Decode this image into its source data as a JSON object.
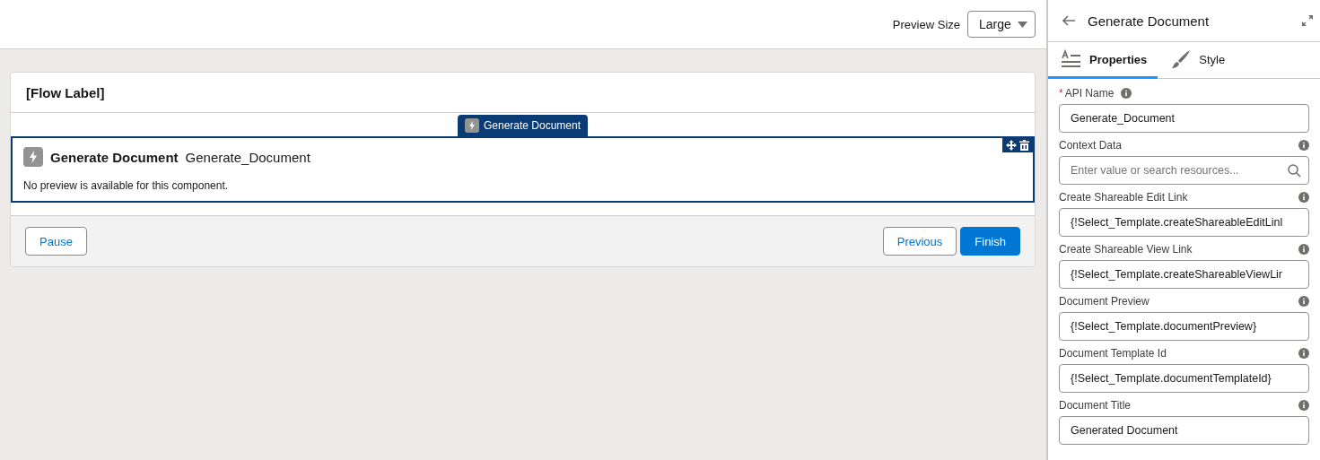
{
  "toolbar": {
    "preview_size_label": "Preview Size",
    "preview_size_value": "Large"
  },
  "screen": {
    "flow_label": "[Flow Label]",
    "component_tab": "Generate Document",
    "component": {
      "title": "Generate Document",
      "api_name": "Generate_Document",
      "message": "No preview is available for this component.",
      "selected": true
    },
    "footer": {
      "left_buttons": [
        {
          "label": "Pause",
          "kind": "neutral"
        }
      ],
      "right_buttons": [
        {
          "label": "Previous",
          "kind": "neutral"
        },
        {
          "label": "Finish",
          "kind": "brand"
        }
      ]
    }
  },
  "panel": {
    "title": "Generate Document",
    "tabs": [
      {
        "label": "Properties",
        "selected": true
      },
      {
        "label": "Style",
        "selected": false
      }
    ],
    "fields": [
      {
        "label": "API Name",
        "required": true,
        "required_mark": "*",
        "kind": "text",
        "value": "Generate_Document"
      },
      {
        "label": "Context Data",
        "required": false,
        "kind": "search",
        "placeholder": "Enter value or search resources..."
      },
      {
        "label": "Create Shareable Edit Link",
        "required": false,
        "kind": "text",
        "value": "{!Select_Template.createShareableEditLinl"
      },
      {
        "label": "Create Shareable View Link",
        "required": false,
        "kind": "text",
        "value": "{!Select_Template.createShareableViewLir"
      },
      {
        "label": "Document Preview",
        "required": false,
        "kind": "text",
        "value": "{!Select_Template.documentPreview}"
      },
      {
        "label": "Document Template Id",
        "required": false,
        "kind": "text",
        "value": "{!Select_Template.documentTemplateId}"
      },
      {
        "label": "Document Title",
        "required": false,
        "kind": "text",
        "value": "Generated Document"
      }
    ]
  }
}
